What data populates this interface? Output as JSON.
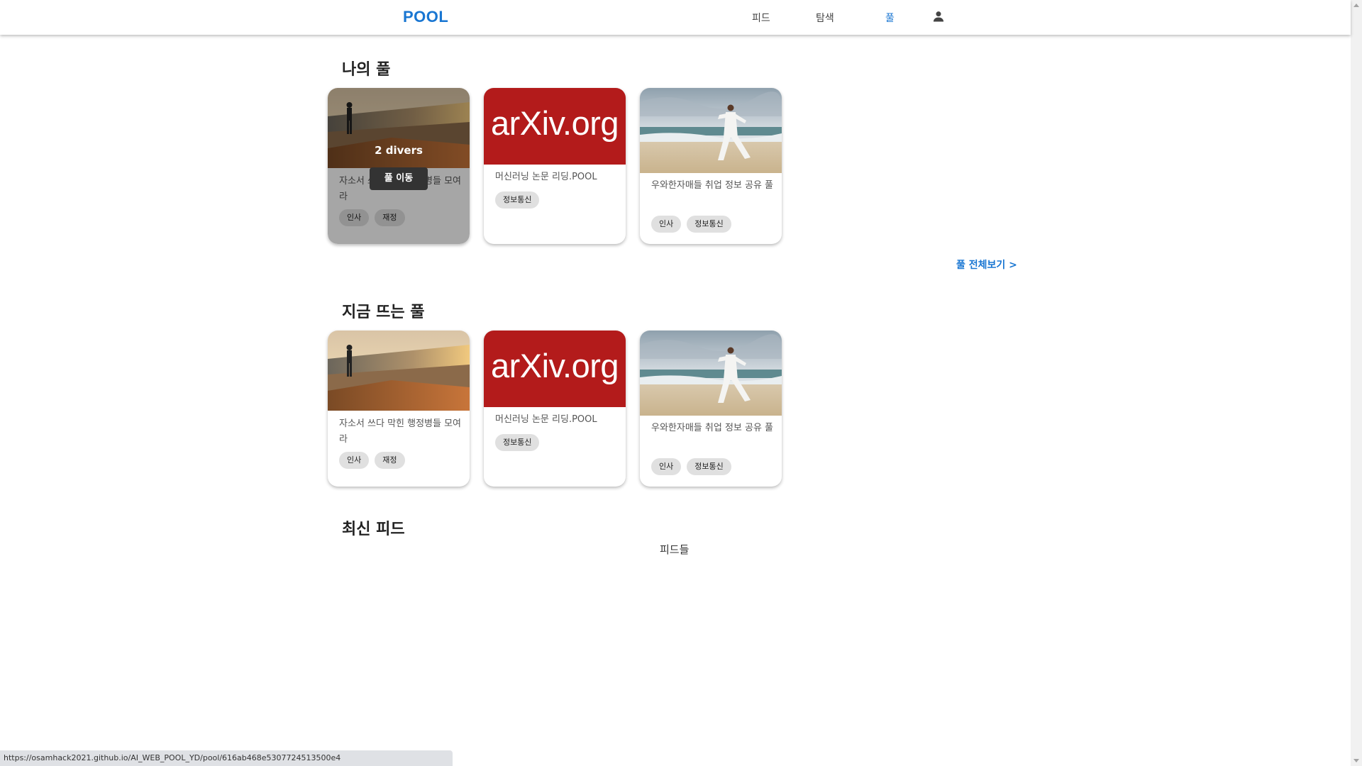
{
  "header": {
    "logo": "POOL",
    "nav": [
      {
        "label": "피드",
        "active": false
      },
      {
        "label": "탐색",
        "active": false
      },
      {
        "label": "풀",
        "active": true
      }
    ],
    "profile_icon": "person-icon"
  },
  "my_pools": {
    "title": "나의 풀",
    "hover": {
      "divers": "2 divers",
      "move_label": "풀 이동"
    },
    "cards": [
      {
        "image": "coastline-sunset-photo",
        "title": "자소서 쓰다 막힌 행정병들 모여라",
        "tags": [
          "인사",
          "재정"
        ]
      },
      {
        "image": "arxiv-logo",
        "image_text": "arXiv.org",
        "title": "머신러닝 논문 리딩.POOL",
        "tags": [
          "정보통신"
        ]
      },
      {
        "image": "beach-taichi-photo",
        "title": "우와한자매들 취업 정보 공유 풀",
        "tags": [
          "인사",
          "정보통신"
        ]
      }
    ],
    "see_all": "풀 전체보기 >"
  },
  "trending_pools": {
    "title": "지금 뜨는 풀",
    "cards": [
      {
        "image": "coastline-sunset-photo",
        "title": "자소서 쓰다 막힌 행정병들 모여라",
        "tags": [
          "인사",
          "재정"
        ]
      },
      {
        "image": "arxiv-logo",
        "image_text": "arXiv.org",
        "title": "머신러닝 논문 리딩.POOL",
        "tags": [
          "정보통신"
        ]
      },
      {
        "image": "beach-taichi-photo",
        "title": "우와한자매들 취업 정보 공유 풀",
        "tags": [
          "인사",
          "정보통신"
        ]
      }
    ]
  },
  "latest_feed": {
    "title": "최신 피드",
    "placeholder": "피드들"
  },
  "status_bar": {
    "url": "https://osamhack2021.github.io/AI_WEB_POOL_YD/pool/616ab468e5307724513500e4"
  },
  "colors": {
    "accent": "#1976d2",
    "arxiv_red": "#b31b1b",
    "tag_bg": "#e0e0e0"
  }
}
